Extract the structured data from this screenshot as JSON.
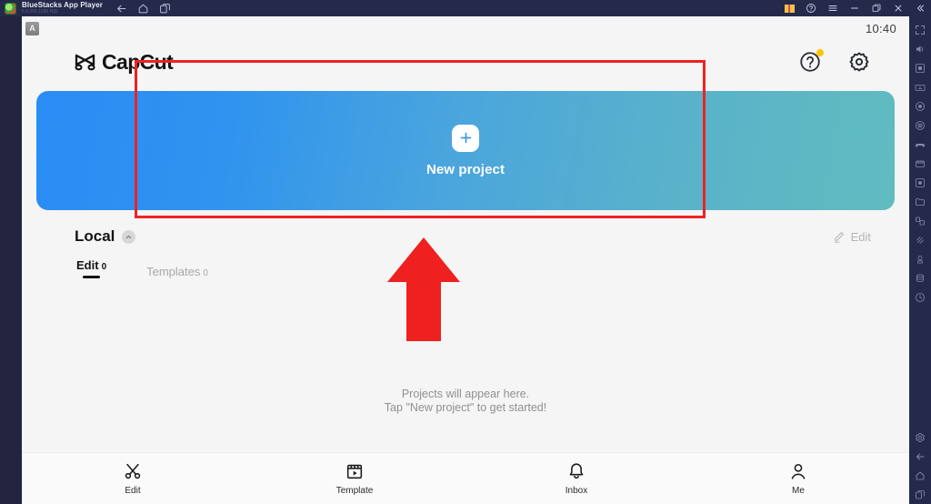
{
  "window": {
    "app_name": "BlueStacks App Player",
    "version": "5.9.350.1035 N32",
    "nav_icons": [
      "back-arrow-icon",
      "home-icon",
      "multi-instance-icon"
    ],
    "control_icons": [
      "gift-icon",
      "help-circle-icon",
      "hamburger-menu-icon",
      "minimize-icon",
      "maximize-icon",
      "close-icon",
      "collapse-icon"
    ]
  },
  "sidebar": {
    "items": [
      {
        "name": "fullscreen-icon"
      },
      {
        "name": "volume-icon"
      },
      {
        "name": "screenshot-icon"
      },
      {
        "name": "keyboard-controls-icon"
      },
      {
        "name": "record-icon"
      },
      {
        "name": "macro-icon"
      },
      {
        "name": "gamepad-icon"
      },
      {
        "name": "media-manager-icon"
      },
      {
        "name": "location-icon"
      },
      {
        "name": "folder-icon"
      },
      {
        "name": "multi-instance-manager-icon"
      },
      {
        "name": "shake-icon"
      },
      {
        "name": "eco-mode-icon"
      },
      {
        "name": "disk-cleanup-icon"
      },
      {
        "name": "rotate-icon"
      }
    ],
    "bottom_items": [
      {
        "name": "settings-gear-icon"
      },
      {
        "name": "back-arrow-icon"
      },
      {
        "name": "home-icon"
      },
      {
        "name": "recents-icon"
      }
    ]
  },
  "android": {
    "status_bar": {
      "badge_letter": "A",
      "time": "10:40"
    },
    "header": {
      "brand_name": "CapCut",
      "help_icon": "help-circle-icon",
      "help_has_badge": true,
      "settings_icon": "gear-icon"
    },
    "banner": {
      "plus_icon": "plus-icon",
      "label": "New project",
      "gradient_start": "#2a8cf5",
      "gradient_end": "#60bcc0"
    },
    "local_section": {
      "title": "Local",
      "collapse_icon": "chevron-up-icon",
      "edit_icon": "pencil-icon",
      "edit_label": "Edit"
    },
    "tabs": [
      {
        "label": "Edit",
        "count": "0",
        "active": true
      },
      {
        "label": "Templates",
        "count": "0",
        "active": false
      }
    ],
    "empty_state": {
      "line1": "Projects will appear here.",
      "line2": "Tap \"New project\" to get started!"
    },
    "bottom_nav": [
      {
        "label": "Edit",
        "icon": "scissors-icon"
      },
      {
        "label": "Template",
        "icon": "clapperboard-play-icon"
      },
      {
        "label": "Inbox",
        "icon": "bell-icon"
      },
      {
        "label": "Me",
        "icon": "person-icon"
      }
    ]
  },
  "annotations": {
    "highlight_rect_color": "#ee2222",
    "arrow_color": "#ee2020",
    "arrow_direction": "up"
  }
}
